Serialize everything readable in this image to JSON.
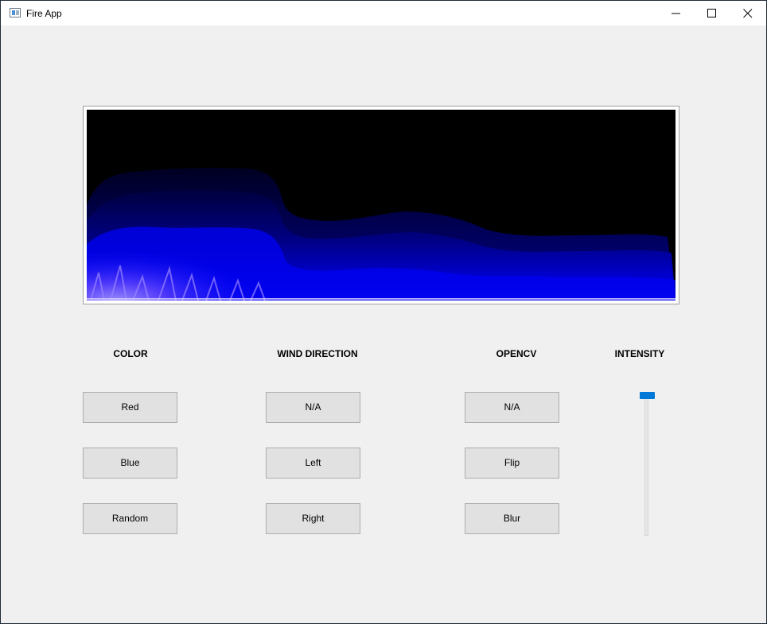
{
  "window": {
    "title": "Fire App",
    "controls": {
      "minimize_icon": "minimize-icon",
      "maximize_icon": "maximize-icon",
      "close_icon": "close-icon"
    }
  },
  "fire_display": {
    "background": "#000000",
    "flame_color": "#0000ff",
    "hot_color": "#b8a0ff"
  },
  "color": {
    "header": "COLOR",
    "buttons": [
      "Red",
      "Blue",
      "Random"
    ]
  },
  "wind_direction": {
    "header": "WIND DIRECTION",
    "buttons": [
      "N/A",
      "Left",
      "Right"
    ]
  },
  "opencv": {
    "header": "OPENCV",
    "buttons": [
      "N/A",
      "Flip",
      "Blur"
    ]
  },
  "intensity": {
    "header": "INTENSITY",
    "value_fraction": 1.0,
    "accent": "#0078d7"
  }
}
